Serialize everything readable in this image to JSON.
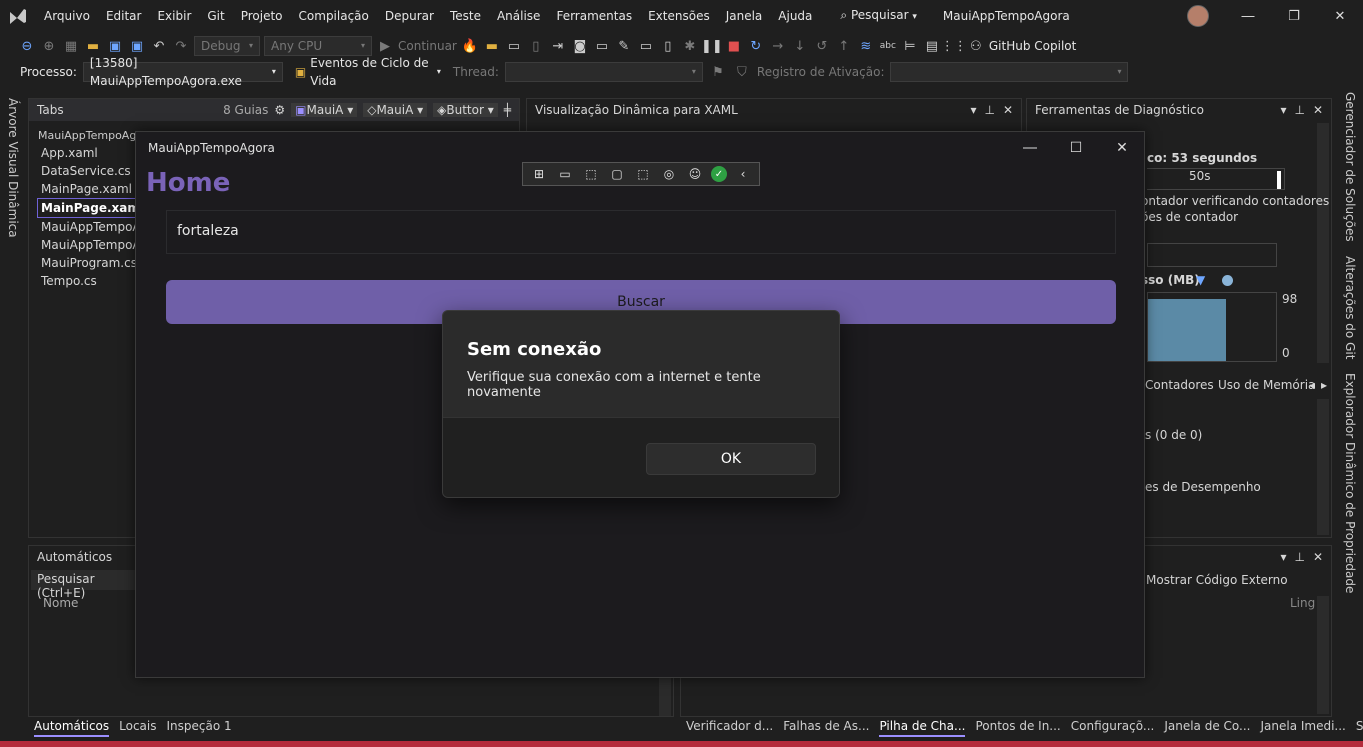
{
  "menu": {
    "items": [
      "Arquivo",
      "Editar",
      "Exibir",
      "Git",
      "Projeto",
      "Compilação",
      "Depurar",
      "Teste",
      "Análise",
      "Ferramentas",
      "Extensões",
      "Janela",
      "Ajuda"
    ],
    "search": "Pesquisar",
    "solution": "MauiAppTempoAgora"
  },
  "toolbar1": {
    "config": "Debug",
    "platform": "Any CPU",
    "continue": "Continuar",
    "copilot": "GitHub Copilot"
  },
  "toolbar2": {
    "process_label": "Processo:",
    "process_value": "[13580] MauiAppTempoAgora.exe",
    "lifecycle": "Eventos de Ciclo de Vida",
    "thread_label": "Thread:",
    "stackframe_label": "Registro de Ativação:"
  },
  "side": {
    "left": "Árvore Visual Dinâmica",
    "right": [
      "Gerenciador de Soluções",
      "Alterações do Git",
      "Explorador Dinâmico de Propriedade"
    ]
  },
  "tabs_panel": {
    "title": "Tabs",
    "count": "8 Guias",
    "tab1": "MauiA",
    "tab2": "MauiA",
    "tab3": "Buttor",
    "files": [
      "MauiAppTempoAgora",
      "App.xaml",
      "DataService.cs",
      "MainPage.xaml",
      "MainPage.xaml.cs",
      "MauiAppTempoA",
      "MauiAppTempoA",
      "MauiProgram.cs",
      "Tempo.cs"
    ],
    "selected_index": 4
  },
  "xaml_panel": {
    "title": "Visualização Dinâmica para XAML"
  },
  "diag_panel": {
    "title": "Ferramentas de Diagnóstico",
    "session": "co: 53 segundos",
    "timeline_tick": "50s",
    "counter_msg1": "ontador verificando contadores",
    "counter_msg2": "ões de contador",
    "memory_label": "sso (MB)",
    "mem_max": "98",
    "mem_min": "0",
    "tab_counters": "Contadores",
    "tab_memory": "Uso de Memória",
    "events": "s (0 de 0)",
    "perf": "es de Desempenho"
  },
  "auto_panel": {
    "title": "Automáticos",
    "search": "Pesquisar (Ctrl+E)",
    "col_name": "Nome"
  },
  "callstack_panel": {
    "external": "Mostrar Código Externo",
    "col_lang": "Ling"
  },
  "bottom_tabs_left": [
    "Automáticos",
    "Locais",
    "Inspeção 1"
  ],
  "bottom_tabs_right": [
    "Verificador d...",
    "Falhas de As...",
    "Pilha de Cha...",
    "Pontos de In...",
    "Configuraçõ...",
    "Janela de Co...",
    "Janela Imedi...",
    "Saída"
  ],
  "app": {
    "title": "MauiAppTempoAgora",
    "heading": "Home",
    "entry_value": "fortaleza",
    "button": "Buscar"
  },
  "dialog": {
    "title": "Sem conexão",
    "message": "Verifique sua conexão com a internet e tente novamente",
    "ok": "OK"
  },
  "colors": {
    "accent": "#7a63b8",
    "button": "#6f5fa8",
    "status": "#b42c3c"
  }
}
